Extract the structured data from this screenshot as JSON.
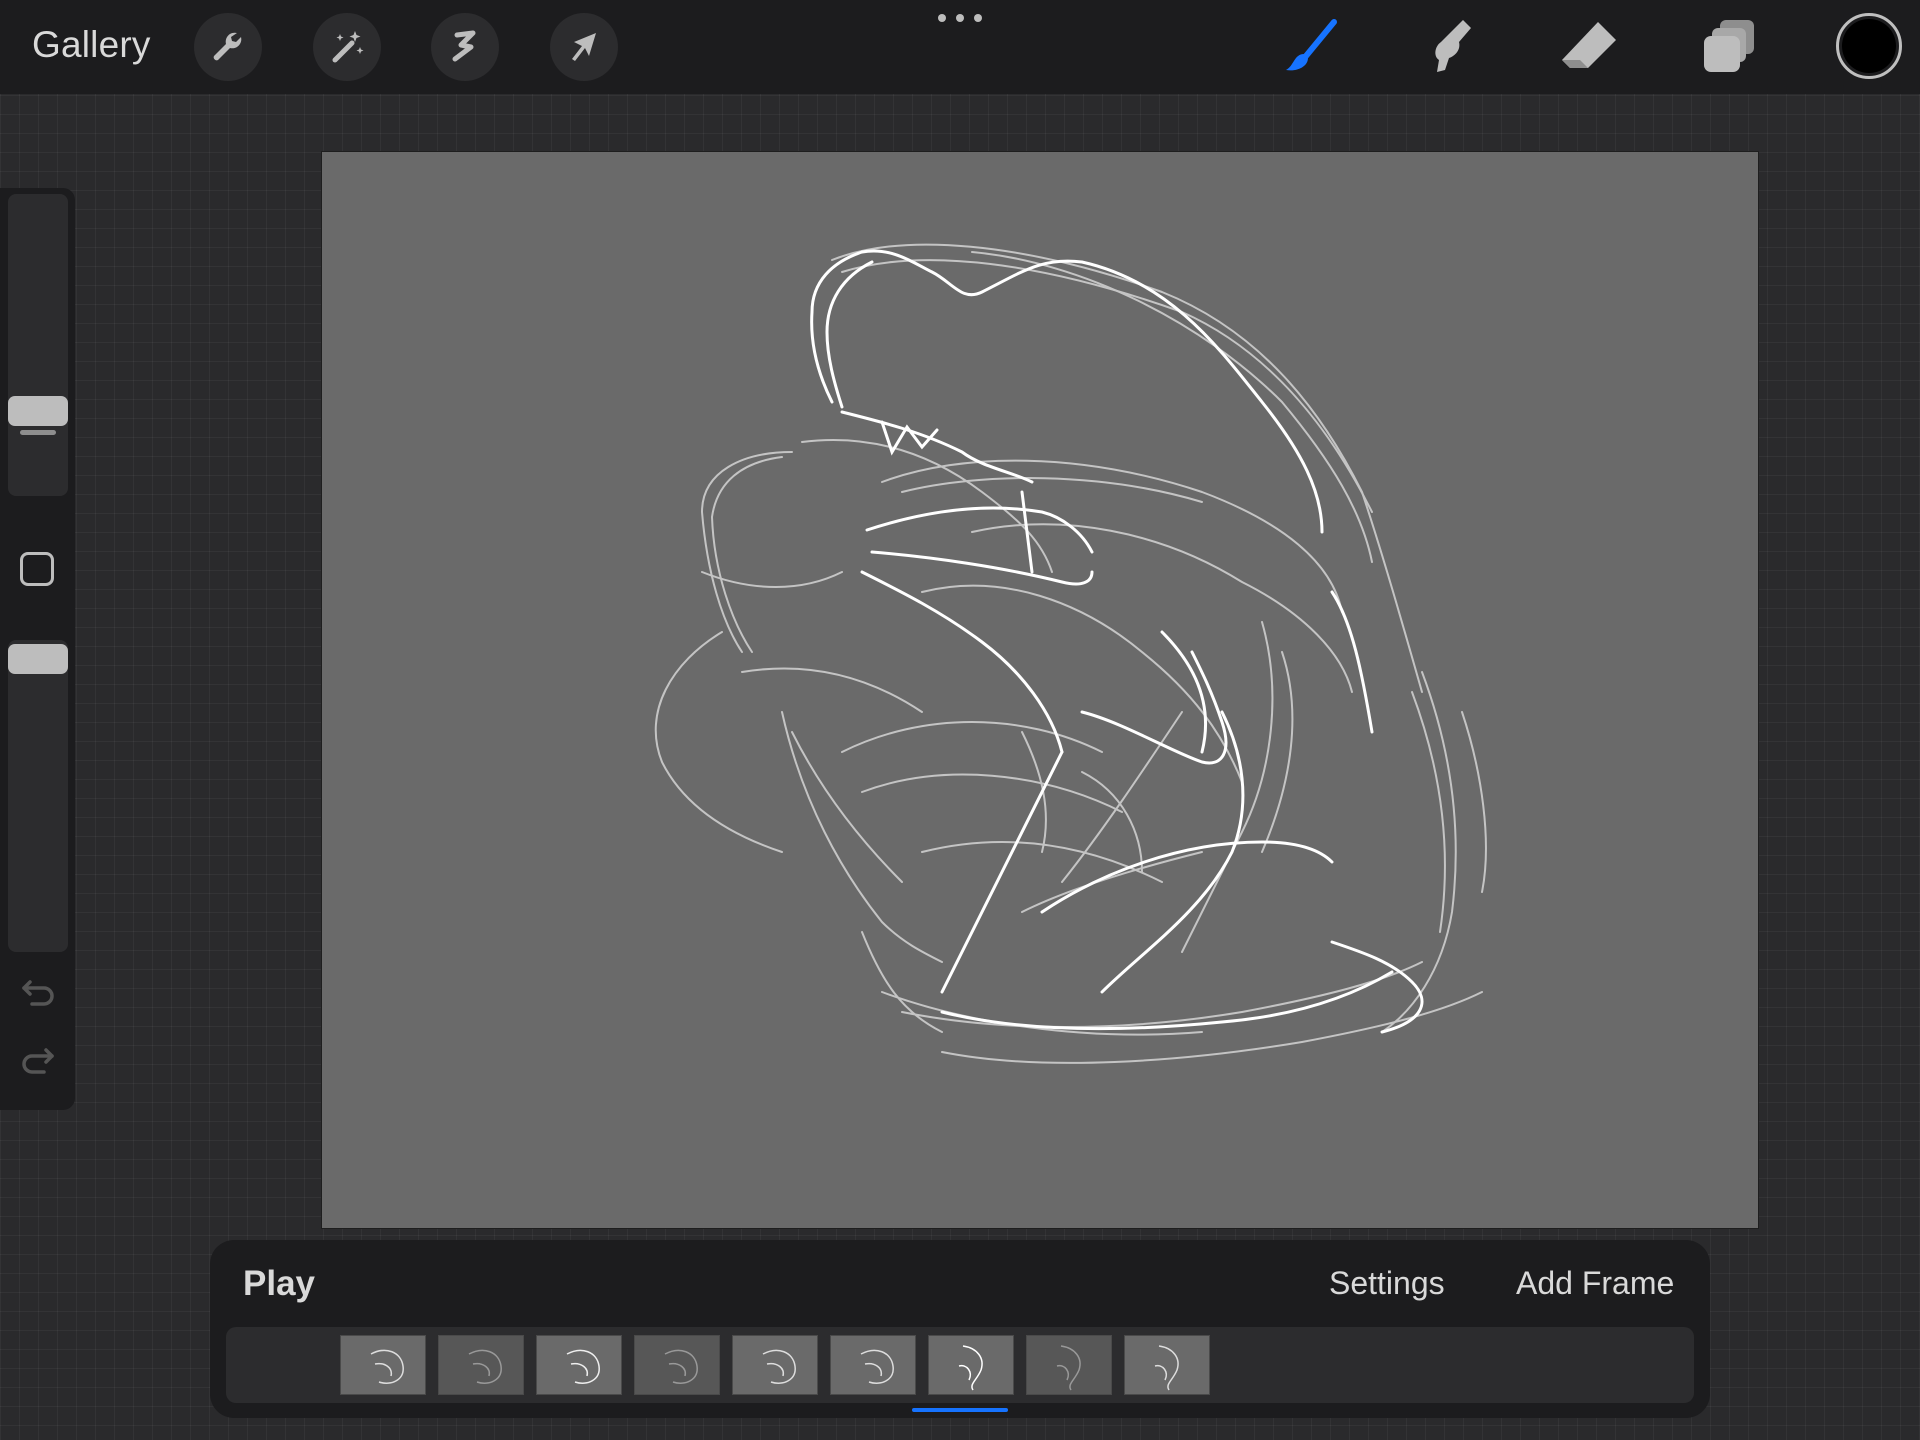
{
  "app": {
    "gallery_label": "Gallery"
  },
  "toolbar": {
    "left_tools": [
      "wrench-icon",
      "magic-wand-icon",
      "selection-icon",
      "transform-arrow-icon"
    ],
    "right_tools": [
      "brush-icon",
      "smudge-icon",
      "eraser-icon",
      "layers-icon"
    ],
    "active_tool": "brush",
    "accent_color": "#1673ff",
    "current_color": "#000000"
  },
  "sidebar": {
    "brush_size_level": 0.68,
    "opacity_level": 1.0
  },
  "canvas": {
    "background_color": "#6a6a6a",
    "stroke_color": "#e6e6e6"
  },
  "animation": {
    "play_label": "Play",
    "settings_label": "Settings",
    "add_frame_label": "Add Frame",
    "frame_count": 9,
    "active_frame": 7
  }
}
